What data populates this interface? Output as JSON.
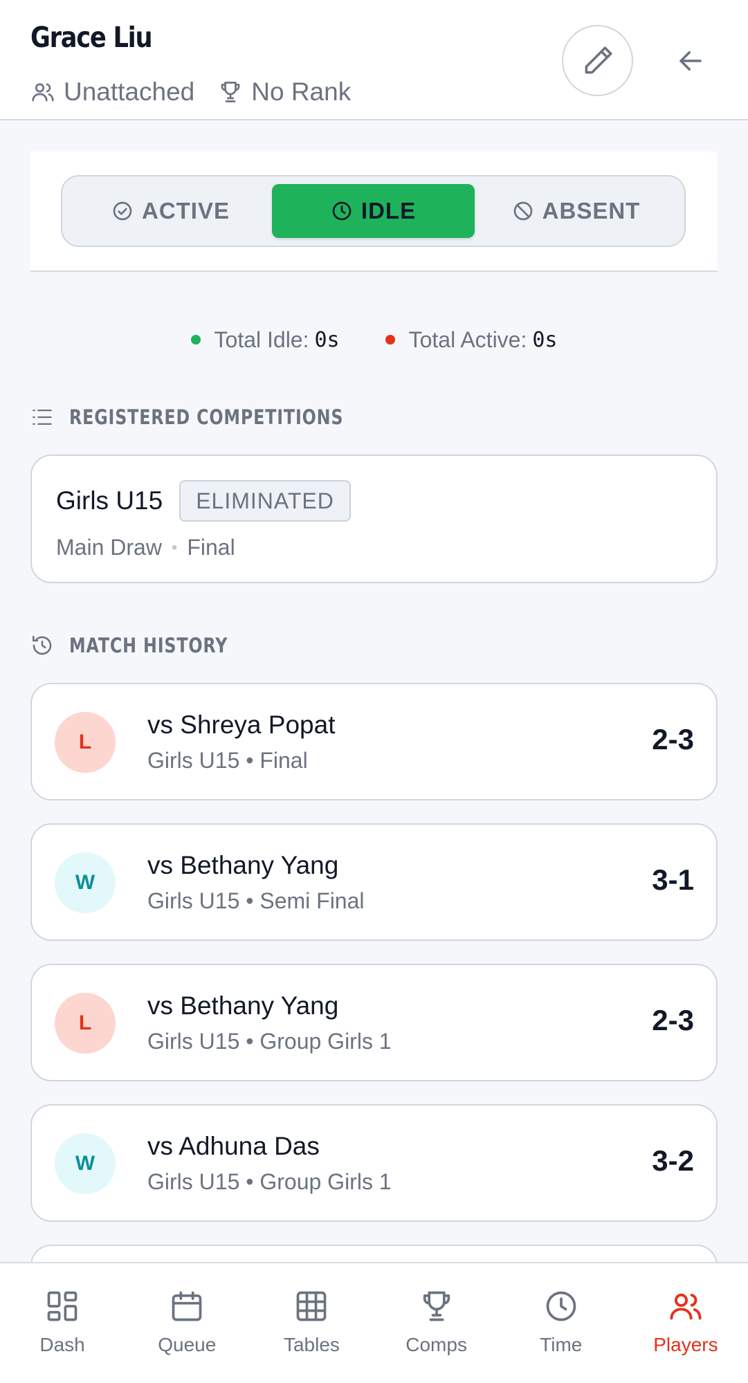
{
  "header": {
    "player_name": "Grace Liu",
    "club": "Unattached",
    "rank": "No Rank"
  },
  "status": {
    "options": [
      {
        "label": "ACTIVE",
        "icon": "check-circle-icon",
        "selected": false
      },
      {
        "label": "IDLE",
        "icon": "clock-icon",
        "selected": true
      },
      {
        "label": "ABSENT",
        "icon": "ban-icon",
        "selected": false
      }
    ],
    "selected_color": "#1eb35a"
  },
  "totals": {
    "idle_label": "Total Idle:",
    "idle_value": "0s",
    "active_label": "Total Active:",
    "active_value": "0s",
    "idle_color": "#1eb35a",
    "active_color": "#e5311a"
  },
  "competitions": {
    "heading": "REGISTERED COMPETITIONS",
    "items": [
      {
        "name": "Girls U15",
        "badge": "ELIMINATED",
        "stage": "Main Draw",
        "round": "Final"
      }
    ]
  },
  "history": {
    "heading": "MATCH HISTORY",
    "matches": [
      {
        "result": "L",
        "opponent": "vs Shreya Popat",
        "detail": "Girls U15 • Final",
        "score": "2-3"
      },
      {
        "result": "W",
        "opponent": "vs Bethany Yang",
        "detail": "Girls U15 • Semi Final",
        "score": "3-1"
      },
      {
        "result": "L",
        "opponent": "vs Bethany Yang",
        "detail": "Girls U15 • Group Girls 1",
        "score": "2-3"
      },
      {
        "result": "W",
        "opponent": "vs Adhuna Das",
        "detail": "Girls U15 • Group Girls 1",
        "score": "3-2"
      }
    ]
  },
  "nav": {
    "items": [
      {
        "label": "Dash",
        "icon": "dashboard-icon"
      },
      {
        "label": "Queue",
        "icon": "calendar-icon"
      },
      {
        "label": "Tables",
        "icon": "grid-icon"
      },
      {
        "label": "Comps",
        "icon": "trophy-icon"
      },
      {
        "label": "Time",
        "icon": "clock-icon"
      },
      {
        "label": "Players",
        "icon": "users-icon"
      }
    ],
    "selected": "Players",
    "accent": "#e5311a"
  }
}
